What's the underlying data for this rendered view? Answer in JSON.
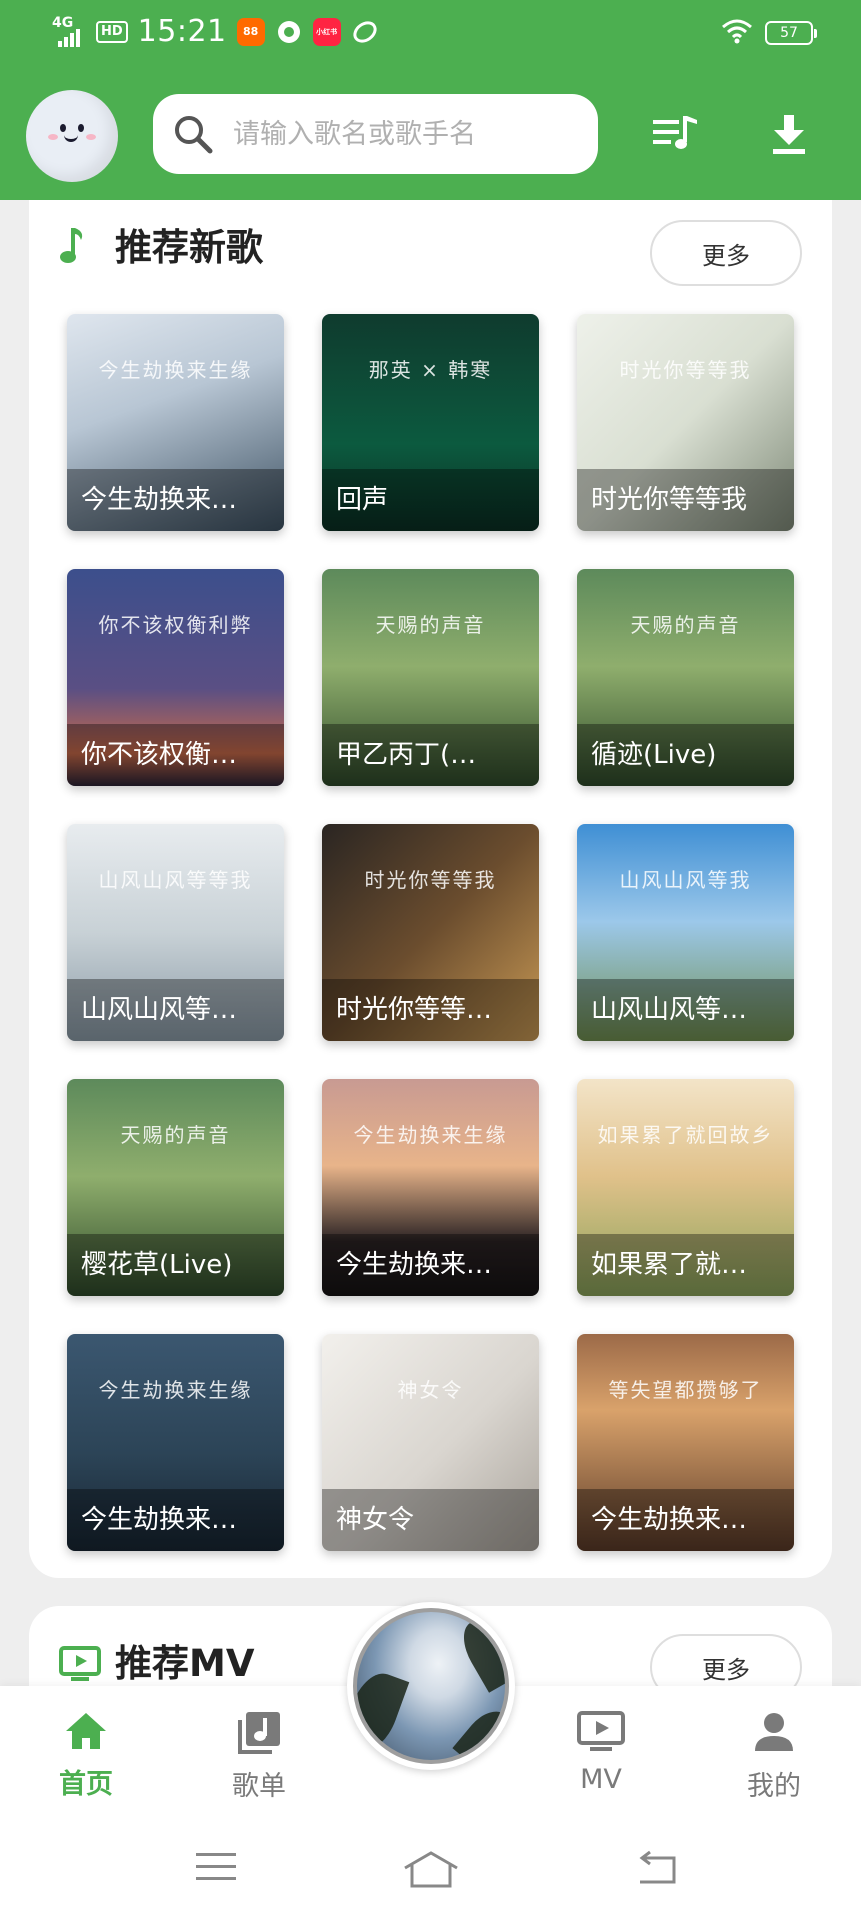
{
  "colors": {
    "brand_green": "#4caf50"
  },
  "status_bar": {
    "network": "4G",
    "hd": "HD",
    "time": "15:21",
    "battery": "57",
    "apps": [
      {
        "icon": "app-orange-icon",
        "label": "88",
        "color": "#ff6a00"
      },
      {
        "icon": "app-circle-icon",
        "label": "",
        "color": "#ffffff"
      },
      {
        "icon": "app-red-icon",
        "label": "小红书",
        "color": "#ff2442"
      },
      {
        "icon": "app-leaf-icon",
        "label": "",
        "color": "#ffffff"
      }
    ]
  },
  "header": {
    "search_placeholder": "请输入歌名或歌手名",
    "playlist_icon": "playlist-icon",
    "download_icon": "download-icon"
  },
  "section_new_songs": {
    "title": "推荐新歌",
    "more": "更多",
    "songs": [
      {
        "title": "今生劫换来…",
        "art_text": "今生劫换来生缘",
        "bg": "linear-gradient(160deg,#dfe6ee 0%,#b8c6d4 40%,#3d5162 100%)"
      },
      {
        "title": "回声",
        "art_text": "那英 × 韩寒",
        "bg": "linear-gradient(180deg,#0f3b2e 0%,#0c5a3f 60%,#0a2f23 100%)"
      },
      {
        "title": "时光你等等我",
        "art_text": "时光你等等我",
        "bg": "linear-gradient(135deg,#eef1ea 0%,#d9dfd2 50%,#7f8a78 100%)"
      },
      {
        "title": "你不该权衡…",
        "art_text": "你不该权衡利弊",
        "bg": "linear-gradient(180deg,#3c4f8c 0%,#5a4f84 55%,#c86a4a 85%,#2a2336 100%)"
      },
      {
        "title": "甲乙丙丁(…",
        "art_text": "天赐的声音",
        "bg": "linear-gradient(180deg,#5d8a5b 0%,#8fae6d 45%,#2f4a2a 100%)"
      },
      {
        "title": "循迹(Live)",
        "art_text": "天赐的声音",
        "bg": "linear-gradient(180deg,#5d8a5b 0%,#8fae6d 45%,#2f4a2a 100%)"
      },
      {
        "title": "山风山风等…",
        "art_text": "山风山风等等我",
        "bg": "linear-gradient(180deg,#e8ecef 0%,#c8d1d6 50%,#8a9aa6 100%)"
      },
      {
        "title": "时光你等等…",
        "art_text": "时光你等等我",
        "bg": "linear-gradient(135deg,#2a2522 0%,#6b4d2e 50%,#c99a55 100%)"
      },
      {
        "title": "山风山风等…",
        "art_text": "山风山风等我",
        "bg": "linear-gradient(180deg,#3f8fd4 0%,#9cc8ea 45%,#6f8e4f 100%)"
      },
      {
        "title": "樱花草(Live)",
        "art_text": "天赐的声音",
        "bg": "linear-gradient(180deg,#5d8a5b 0%,#8fae6d 45%,#2f4a2a 100%)"
      },
      {
        "title": "今生劫换来…",
        "art_text": "今生劫换来生缘",
        "bg": "linear-gradient(180deg,#c89a92 0%,#e8b48a 40%,#2b2324 75%,#151213 100%)"
      },
      {
        "title": "如果累了就…",
        "art_text": "如果累了就回故乡",
        "bg": "linear-gradient(180deg,#f3e4c8 0%,#e0c18a 45%,#8aa35a 100%)"
      },
      {
        "title": "今生劫换来…",
        "art_text": "今生劫换来生缘",
        "bg": "linear-gradient(180deg,#3b5770 0%,#2c4457 55%,#182633 100%)"
      },
      {
        "title": "神女令",
        "art_text": "神女令",
        "bg": "linear-gradient(135deg,#f2f0ec 0%,#d9d5cf 55%,#a9a39b 100%)"
      },
      {
        "title": "今生劫换来…",
        "art_text": "等失望都攒够了",
        "bg": "linear-gradient(180deg,#9c6a48 0%,#d9a26b 35%,#5a3a28 100%)"
      }
    ]
  },
  "section_mv": {
    "title": "推荐MV",
    "more": "更多"
  },
  "bottom_nav": {
    "items": [
      {
        "label": "首页",
        "icon": "home-icon",
        "active": true
      },
      {
        "label": "歌单",
        "icon": "songlist-icon",
        "active": false
      },
      {
        "label": "MV",
        "icon": "mv-icon",
        "active": false
      },
      {
        "label": "我的",
        "icon": "user-icon",
        "active": false
      }
    ]
  }
}
